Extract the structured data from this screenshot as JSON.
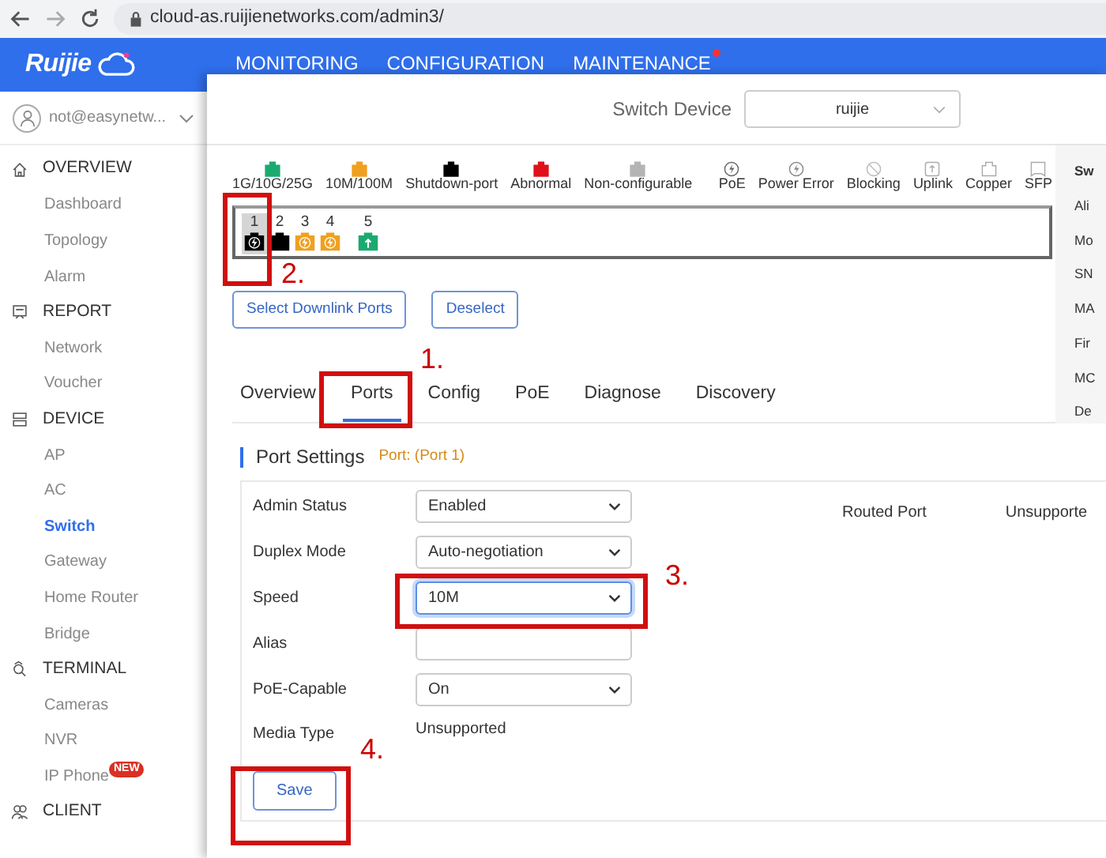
{
  "browser": {
    "url": "cloud-as.ruijienetworks.com/admin3/"
  },
  "header": {
    "logo": "Ruijie",
    "nav": [
      {
        "label": "MONITORING",
        "alert": false
      },
      {
        "label": "CONFIGURATION",
        "alert": false
      },
      {
        "label": "MAINTENANCE",
        "alert": true
      }
    ]
  },
  "account": {
    "name": "not@easynetw..."
  },
  "sidebar": {
    "sections": [
      {
        "label": "OVERVIEW",
        "children": [
          {
            "label": "Dashboard",
            "selected": false
          },
          {
            "label": "Topology",
            "selected": false
          },
          {
            "label": "Alarm",
            "selected": false
          }
        ]
      },
      {
        "label": "REPORT",
        "children": [
          {
            "label": "Network",
            "selected": false
          },
          {
            "label": "Voucher",
            "selected": false
          }
        ]
      },
      {
        "label": "DEVICE",
        "children": [
          {
            "label": "AP",
            "selected": false
          },
          {
            "label": "AC",
            "selected": false
          },
          {
            "label": "Switch",
            "selected": true
          },
          {
            "label": "Gateway",
            "selected": false
          },
          {
            "label": "Home Router",
            "selected": false
          },
          {
            "label": "Bridge",
            "selected": false
          }
        ]
      },
      {
        "label": "TERMINAL",
        "children": [
          {
            "label": "Cameras",
            "selected": false
          },
          {
            "label": "NVR",
            "selected": false
          },
          {
            "label": "IP Phone",
            "selected": false,
            "badge": "NEW"
          }
        ]
      },
      {
        "label": "CLIENT"
      }
    ]
  },
  "device_select": {
    "label": "Switch Device",
    "value": "ruijie"
  },
  "legend": {
    "colors": [
      {
        "label": "1G/10G/25G",
        "color": "#1aaa6f"
      },
      {
        "label": "10M/100M",
        "color": "#f0a020"
      },
      {
        "label": "Shutdown-port",
        "color": "#000000"
      },
      {
        "label": "Abnormal",
        "color": "#e0101a"
      },
      {
        "label": "Non-configurable",
        "color": "#b4b4b4"
      }
    ],
    "icons": [
      {
        "label": "PoE",
        "kind": "poe"
      },
      {
        "label": "Power Error",
        "kind": "power-error"
      },
      {
        "label": "Blocking",
        "kind": "blocking"
      },
      {
        "label": "Uplink",
        "kind": "uplink"
      },
      {
        "label": "Copper",
        "kind": "copper"
      },
      {
        "label": "SFP",
        "kind": "sfp"
      }
    ]
  },
  "ports": [
    {
      "number": "1",
      "color": "#000000",
      "kind": "poe",
      "selected": true
    },
    {
      "number": "2",
      "color": "#000000",
      "kind": "copper",
      "selected": false
    },
    {
      "number": "3",
      "color": "#f0a020",
      "kind": "poe",
      "selected": false
    },
    {
      "number": "4",
      "color": "#f0a020",
      "kind": "poe",
      "selected": false
    },
    {
      "number": "5",
      "color": "#1aaa6f",
      "kind": "uplink",
      "selected": false
    }
  ],
  "port_buttons": [
    "Select Downlink Ports",
    "Deselect"
  ],
  "side_panel": {
    "labels": [
      "Sw",
      "Ali",
      "Mo",
      "SN",
      "MA",
      "Fir",
      "MC",
      "De"
    ]
  },
  "tabs": [
    {
      "label": "Overview",
      "selected": false
    },
    {
      "label": "Ports",
      "selected": true
    },
    {
      "label": "Config",
      "selected": false
    },
    {
      "label": "PoE",
      "selected": false
    },
    {
      "label": "Diagnose",
      "selected": false
    },
    {
      "label": "Discovery",
      "selected": false
    }
  ],
  "section": {
    "title": "Port Settings",
    "port": "Port: (Port 1)"
  },
  "form": {
    "fields": [
      {
        "label": "Admin Status",
        "kind": "select",
        "value": "Enabled",
        "focused": false
      },
      {
        "label": "Duplex Mode",
        "kind": "select",
        "value": "Auto-negotiation",
        "focused": false
      },
      {
        "label": "Speed",
        "kind": "select",
        "value": "10M",
        "focused": true
      },
      {
        "label": "Alias",
        "kind": "text",
        "focused": false
      },
      {
        "label": "PoE-Capable",
        "kind": "select",
        "value": "On",
        "focused": false
      },
      {
        "label": "Media Type",
        "kind": "static",
        "value": "Unsupported"
      }
    ],
    "extra": {
      "label": "Routed Port",
      "value": "Unsupporte"
    },
    "save": "Save"
  },
  "annotations": [
    {
      "number": "2."
    },
    {
      "number": "1."
    },
    {
      "number": "3."
    },
    {
      "number": "4."
    }
  ]
}
